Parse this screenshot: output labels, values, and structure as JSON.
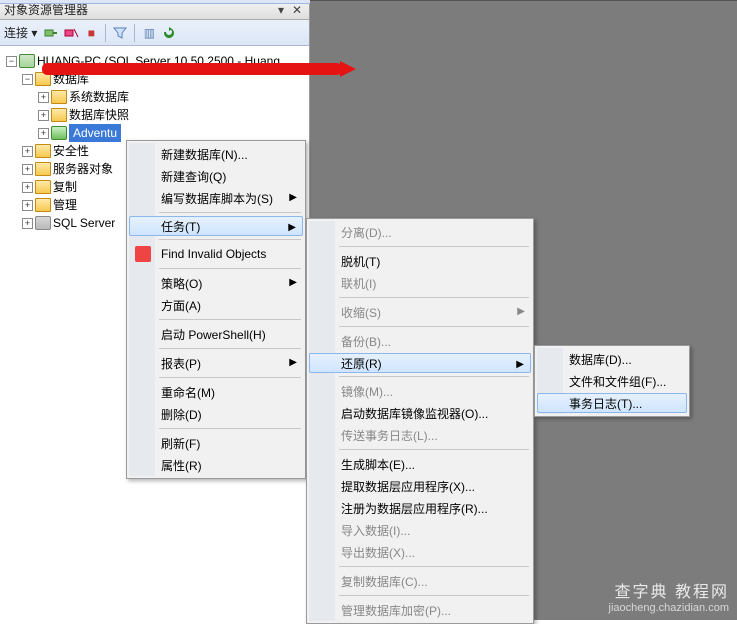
{
  "panel": {
    "title": "对象资源管理器",
    "pin_glyph": "▾",
    "close_glyph": "✕",
    "connect_label": "连接 ▾",
    "pile_glyph": "▥"
  },
  "tree": {
    "server": "HUANG-PC (SQL Server 10.50.2500 - Huang...",
    "db_root": "数据库",
    "sys_db": "系统数据库",
    "snapshot": "数据库快照",
    "sel_db": "Adventu",
    "security": "安全性",
    "server_obj": "服务器对象",
    "replication": "复制",
    "mgmt": "管理",
    "agent": "SQL Server"
  },
  "menu1": {
    "new_db": "新建数据库(N)...",
    "new_query": "新建查询(Q)",
    "script_db": "编写数据库脚本为(S)",
    "tasks": "任务(T)",
    "find_invalid": "Find Invalid Objects",
    "policies": "策略(O)",
    "facets": "方面(A)",
    "powershell": "启动 PowerShell(H)",
    "reports": "报表(P)",
    "rename": "重命名(M)",
    "delete": "删除(D)",
    "refresh": "刷新(F)",
    "properties": "属性(R)"
  },
  "menu2": {
    "detach": "分离(D)...",
    "offline": "脱机(T)",
    "online": "联机(I)",
    "shrink": "收缩(S)",
    "backup": "备份(B)...",
    "restore": "还原(R)",
    "mirror": "镜像(M)...",
    "launch_monitor": "启动数据库镜像监视器(O)...",
    "ship_logs": "传送事务日志(L)...",
    "gen_scripts": "生成脚本(E)...",
    "extract_dac": "提取数据层应用程序(X)...",
    "register_dac": "注册为数据层应用程序(R)...",
    "import": "导入数据(I)...",
    "export": "导出数据(X)...",
    "copy_db": "复制数据库(C)...",
    "manage_enc": "管理数据库加密(P)..."
  },
  "menu3": {
    "database": "数据库(D)...",
    "files": "文件和文件组(F)...",
    "txlog": "事务日志(T)..."
  },
  "watermark": {
    "l1": "查字典 教程网",
    "l2": "jiaocheng.chazidian.com"
  }
}
